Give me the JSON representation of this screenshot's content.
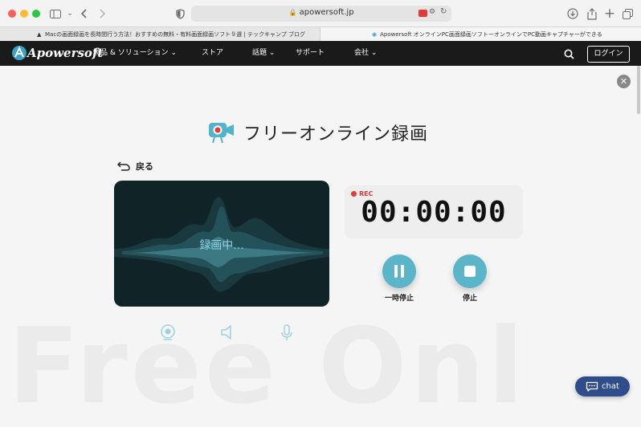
{
  "browser": {
    "url": "apowersoft.jp",
    "tabs": [
      {
        "label": "Macの画面録画を長時間行う方法！おすすめの無料・有料画面録画ソフト９選 | テックキャンプ ブログ",
        "active": false
      },
      {
        "label": "Apowersoft オンラインPC画面録画ソフトーオンラインでPC動画キャプチャーができる",
        "active": true
      }
    ]
  },
  "site": {
    "logo": "Apowersoft",
    "nav": [
      "製品 & ソリューション",
      "ストア",
      "話題",
      "サポート",
      "会社"
    ],
    "login": "ログイン"
  },
  "main": {
    "title": "フリーオンライン録画",
    "back": "戻る",
    "recording_status": "録画中...",
    "rec_label": "REC",
    "timer": "00:00:00",
    "pause_label": "一時停止",
    "stop_label": "停止",
    "background_word": "Free Onl",
    "chat": "chat"
  },
  "colors": {
    "accent": "#5bb5c9",
    "panel": "#102428",
    "rec": "#e23b3b",
    "nav_bg": "#1a1a1a",
    "chat": "#2f4d8a"
  }
}
